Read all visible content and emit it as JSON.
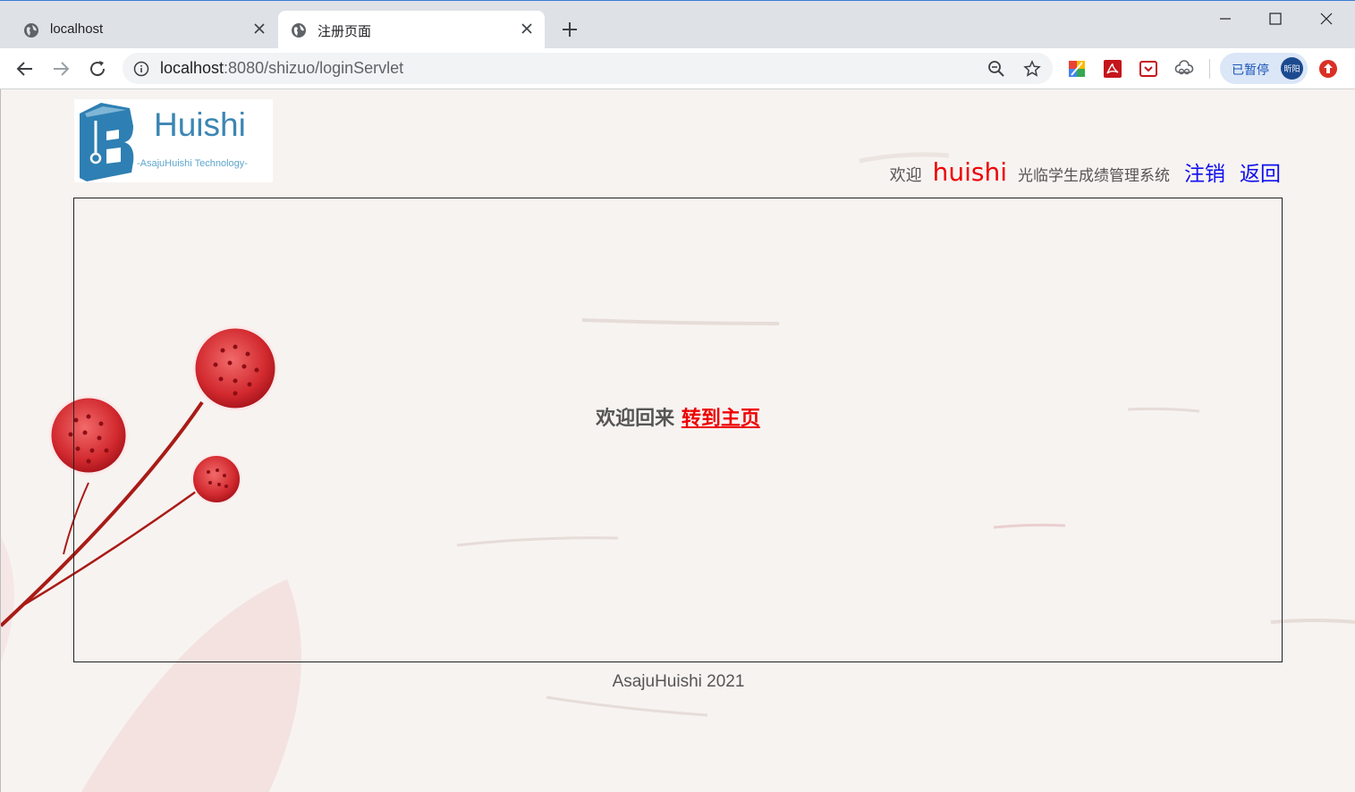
{
  "browser": {
    "tabs": [
      {
        "label": "localhost",
        "icon": "globe-icon",
        "active": false
      },
      {
        "label": "注册页面",
        "icon": "globe-icon",
        "active": true
      }
    ],
    "url": {
      "host": "localhost",
      "rest": ":8080/shizuo/loginServlet"
    },
    "profile": {
      "status_label": "已暂停",
      "avatar_text": "昕阳"
    },
    "extensions": [
      "color-picker-icon",
      "pdf-icon",
      "pocket-icon",
      "cloud-link-icon"
    ],
    "accent_color": "#3a7bd5"
  },
  "page": {
    "logo": {
      "word": "Huishi",
      "subtitle": "-AsajuHuishi Technology-",
      "color": "#3b86b3"
    },
    "header": {
      "welcome_prefix": "欢迎",
      "username": "huishi",
      "system_name": "光临学生成绩管理系统",
      "logout_label": "注销",
      "back_label": "返回"
    },
    "main": {
      "message": "欢迎回来",
      "home_link": "转到主页"
    },
    "footer": "AsajuHuishi 2021"
  }
}
